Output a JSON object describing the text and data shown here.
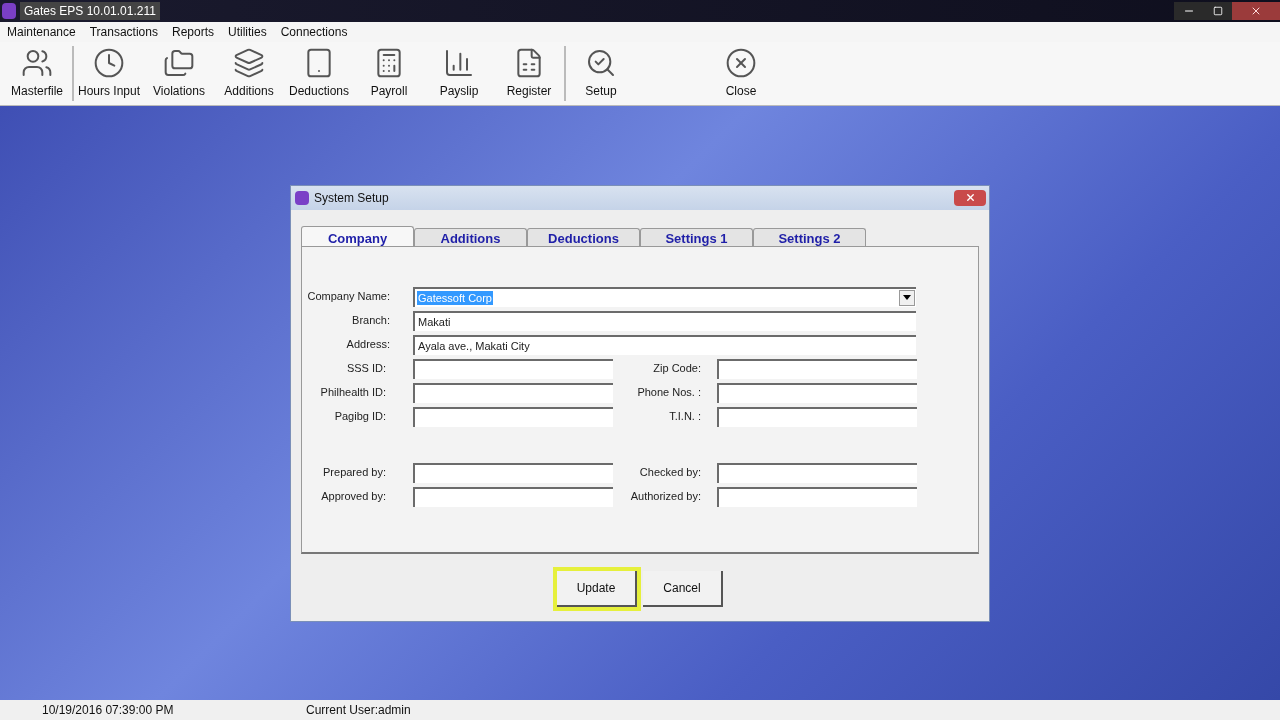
{
  "window": {
    "title": "Gates EPS 10.01.01.211"
  },
  "menu": [
    "Maintenance",
    "Transactions",
    "Reports",
    "Utilities",
    "Connections"
  ],
  "toolbar": [
    {
      "label": "Masterfile",
      "separator_after": true
    },
    {
      "label": "Hours Input",
      "separator_after": false
    },
    {
      "label": "Violations",
      "separator_after": false
    },
    {
      "label": "Additions",
      "separator_after": false
    },
    {
      "label": "Deductions",
      "separator_after": false
    },
    {
      "label": "Payroll",
      "separator_after": false
    },
    {
      "label": "Payslip",
      "separator_after": false
    },
    {
      "label": "Register",
      "separator_after": true
    },
    {
      "label": "Setup",
      "separator_after": false
    },
    {
      "label": "Close",
      "separator_after": false
    }
  ],
  "dialog": {
    "title": "System Setup",
    "tabs": [
      {
        "label": "Company",
        "selected": true
      },
      {
        "label": "Additions",
        "selected": false
      },
      {
        "label": "Deductions",
        "selected": false
      },
      {
        "label": "Settings 1",
        "selected": false
      },
      {
        "label": "Settings 2",
        "selected": false
      }
    ],
    "full_fields": [
      {
        "label": "Company Name:",
        "value": "Gatessoft Corp",
        "kind": "combo",
        "text_selected": true
      },
      {
        "label": "Branch:",
        "value": "Makati",
        "kind": "text",
        "text_selected": false
      },
      {
        "label": "Address:",
        "value": "Ayala ave., Makati City",
        "kind": "text",
        "text_selected": false
      }
    ],
    "pair_groups": [
      [
        [
          {
            "label": "SSS ID:"
          },
          {
            "label": "Zip Code:"
          }
        ],
        [
          {
            "label": "Philhealth ID:"
          },
          {
            "label": "Phone Nos. :"
          }
        ],
        [
          {
            "label": "Pagibg ID:"
          },
          {
            "label": "T.I.N. :"
          }
        ]
      ],
      [
        [
          {
            "label": "Prepared by:"
          },
          {
            "label": "Checked by:"
          }
        ],
        [
          {
            "label": "Approved by:"
          },
          {
            "label": "Authorized by:"
          }
        ]
      ]
    ],
    "buttons": [
      {
        "label": "Update",
        "highlighted": true
      },
      {
        "label": "Cancel",
        "highlighted": false
      }
    ]
  },
  "status_bar": {
    "datetime": "10/19/2016 07:39:00 PM",
    "user": "Current User:admin"
  }
}
